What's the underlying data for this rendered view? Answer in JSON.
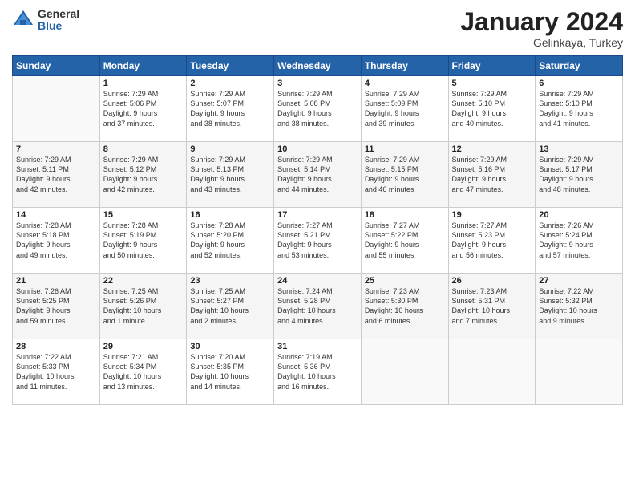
{
  "header": {
    "logo_general": "General",
    "logo_blue": "Blue",
    "month_title": "January 2024",
    "location": "Gelinkaya, Turkey"
  },
  "days_of_week": [
    "Sunday",
    "Monday",
    "Tuesday",
    "Wednesday",
    "Thursday",
    "Friday",
    "Saturday"
  ],
  "weeks": [
    [
      {
        "day": "",
        "info": ""
      },
      {
        "day": "1",
        "info": "Sunrise: 7:29 AM\nSunset: 5:06 PM\nDaylight: 9 hours\nand 37 minutes."
      },
      {
        "day": "2",
        "info": "Sunrise: 7:29 AM\nSunset: 5:07 PM\nDaylight: 9 hours\nand 38 minutes."
      },
      {
        "day": "3",
        "info": "Sunrise: 7:29 AM\nSunset: 5:08 PM\nDaylight: 9 hours\nand 38 minutes."
      },
      {
        "day": "4",
        "info": "Sunrise: 7:29 AM\nSunset: 5:09 PM\nDaylight: 9 hours\nand 39 minutes."
      },
      {
        "day": "5",
        "info": "Sunrise: 7:29 AM\nSunset: 5:10 PM\nDaylight: 9 hours\nand 40 minutes."
      },
      {
        "day": "6",
        "info": "Sunrise: 7:29 AM\nSunset: 5:10 PM\nDaylight: 9 hours\nand 41 minutes."
      }
    ],
    [
      {
        "day": "7",
        "info": "Sunrise: 7:29 AM\nSunset: 5:11 PM\nDaylight: 9 hours\nand 42 minutes."
      },
      {
        "day": "8",
        "info": "Sunrise: 7:29 AM\nSunset: 5:12 PM\nDaylight: 9 hours\nand 42 minutes."
      },
      {
        "day": "9",
        "info": "Sunrise: 7:29 AM\nSunset: 5:13 PM\nDaylight: 9 hours\nand 43 minutes."
      },
      {
        "day": "10",
        "info": "Sunrise: 7:29 AM\nSunset: 5:14 PM\nDaylight: 9 hours\nand 44 minutes."
      },
      {
        "day": "11",
        "info": "Sunrise: 7:29 AM\nSunset: 5:15 PM\nDaylight: 9 hours\nand 46 minutes."
      },
      {
        "day": "12",
        "info": "Sunrise: 7:29 AM\nSunset: 5:16 PM\nDaylight: 9 hours\nand 47 minutes."
      },
      {
        "day": "13",
        "info": "Sunrise: 7:29 AM\nSunset: 5:17 PM\nDaylight: 9 hours\nand 48 minutes."
      }
    ],
    [
      {
        "day": "14",
        "info": "Sunrise: 7:28 AM\nSunset: 5:18 PM\nDaylight: 9 hours\nand 49 minutes."
      },
      {
        "day": "15",
        "info": "Sunrise: 7:28 AM\nSunset: 5:19 PM\nDaylight: 9 hours\nand 50 minutes."
      },
      {
        "day": "16",
        "info": "Sunrise: 7:28 AM\nSunset: 5:20 PM\nDaylight: 9 hours\nand 52 minutes."
      },
      {
        "day": "17",
        "info": "Sunrise: 7:27 AM\nSunset: 5:21 PM\nDaylight: 9 hours\nand 53 minutes."
      },
      {
        "day": "18",
        "info": "Sunrise: 7:27 AM\nSunset: 5:22 PM\nDaylight: 9 hours\nand 55 minutes."
      },
      {
        "day": "19",
        "info": "Sunrise: 7:27 AM\nSunset: 5:23 PM\nDaylight: 9 hours\nand 56 minutes."
      },
      {
        "day": "20",
        "info": "Sunrise: 7:26 AM\nSunset: 5:24 PM\nDaylight: 9 hours\nand 57 minutes."
      }
    ],
    [
      {
        "day": "21",
        "info": "Sunrise: 7:26 AM\nSunset: 5:25 PM\nDaylight: 9 hours\nand 59 minutes."
      },
      {
        "day": "22",
        "info": "Sunrise: 7:25 AM\nSunset: 5:26 PM\nDaylight: 10 hours\nand 1 minute."
      },
      {
        "day": "23",
        "info": "Sunrise: 7:25 AM\nSunset: 5:27 PM\nDaylight: 10 hours\nand 2 minutes."
      },
      {
        "day": "24",
        "info": "Sunrise: 7:24 AM\nSunset: 5:28 PM\nDaylight: 10 hours\nand 4 minutes."
      },
      {
        "day": "25",
        "info": "Sunrise: 7:23 AM\nSunset: 5:30 PM\nDaylight: 10 hours\nand 6 minutes."
      },
      {
        "day": "26",
        "info": "Sunrise: 7:23 AM\nSunset: 5:31 PM\nDaylight: 10 hours\nand 7 minutes."
      },
      {
        "day": "27",
        "info": "Sunrise: 7:22 AM\nSunset: 5:32 PM\nDaylight: 10 hours\nand 9 minutes."
      }
    ],
    [
      {
        "day": "28",
        "info": "Sunrise: 7:22 AM\nSunset: 5:33 PM\nDaylight: 10 hours\nand 11 minutes."
      },
      {
        "day": "29",
        "info": "Sunrise: 7:21 AM\nSunset: 5:34 PM\nDaylight: 10 hours\nand 13 minutes."
      },
      {
        "day": "30",
        "info": "Sunrise: 7:20 AM\nSunset: 5:35 PM\nDaylight: 10 hours\nand 14 minutes."
      },
      {
        "day": "31",
        "info": "Sunrise: 7:19 AM\nSunset: 5:36 PM\nDaylight: 10 hours\nand 16 minutes."
      },
      {
        "day": "",
        "info": ""
      },
      {
        "day": "",
        "info": ""
      },
      {
        "day": "",
        "info": ""
      }
    ]
  ]
}
